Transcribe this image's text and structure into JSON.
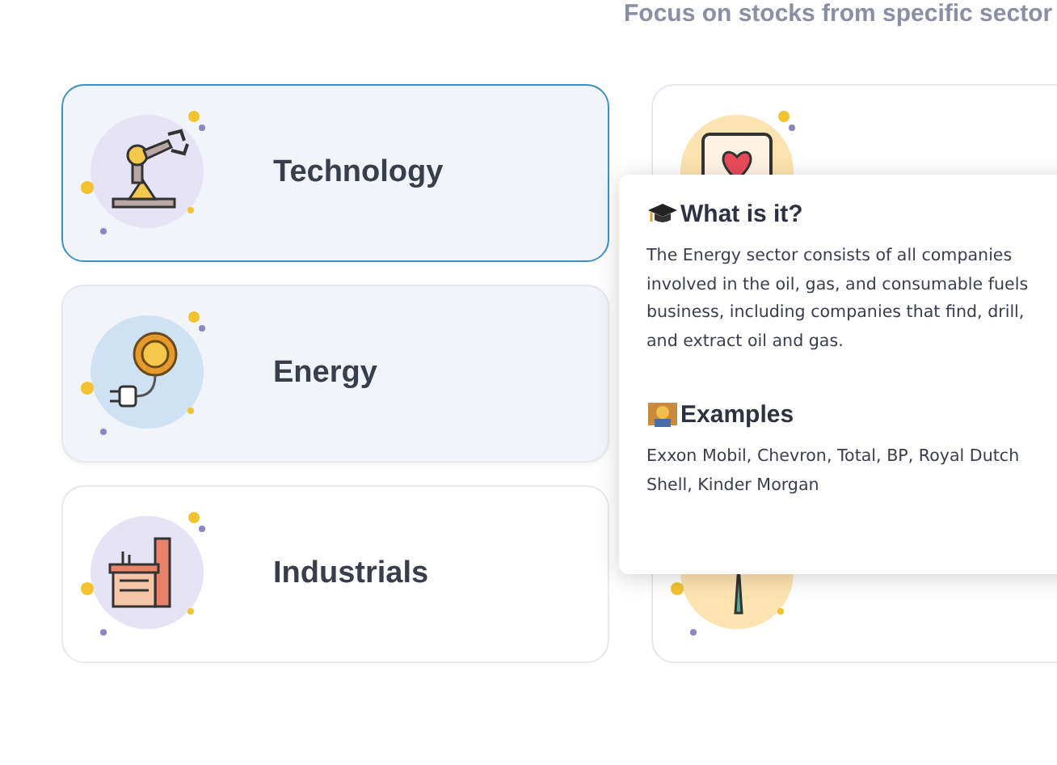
{
  "subtitle": "Focus on stocks from specific sector",
  "sectors_left": [
    {
      "label": "Technology",
      "kind": "robot",
      "selected": true,
      "hovered": false
    },
    {
      "label": "Energy",
      "kind": "solar",
      "selected": false,
      "hovered": true
    },
    {
      "label": "Industrials",
      "kind": "factory",
      "selected": false,
      "hovered": false
    }
  ],
  "sectors_right": [
    {
      "kind": "heart",
      "selected": false,
      "hovered": false
    },
    {
      "kind": "turbine",
      "selected": false,
      "hovered": false
    }
  ],
  "tooltip": {
    "sections": [
      {
        "kind": "cap",
        "heading": "What is it?",
        "text": "The Energy sector consists of all companies involved in the oil, gas, and consumable fuels business, including companies that find, drill, and extract oil and gas."
      },
      {
        "kind": "teacher",
        "heading": "Examples",
        "text": "Exxon Mobil, Chevron, Total, BP, Royal Dutch Shell, Kinder Morgan"
      }
    ]
  }
}
